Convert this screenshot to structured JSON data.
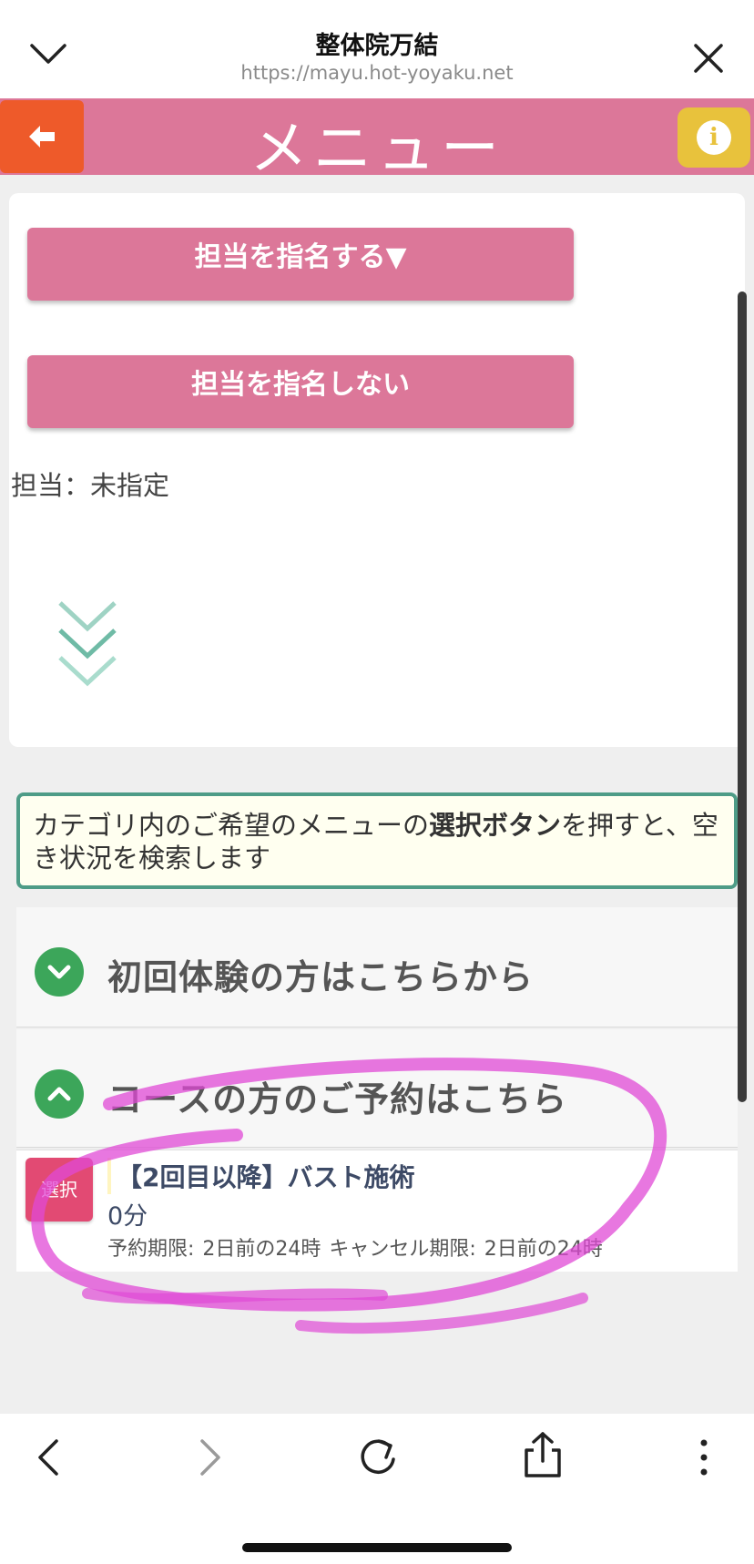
{
  "browser": {
    "site_title": "整体院万結",
    "url": "https://mayu.hot-yoyaku.net"
  },
  "header": {
    "title": "メニュー",
    "info_glyph": "i"
  },
  "staff": {
    "nominate_button": "担当を指名する▼",
    "no_nominate_button": "担当を指名しない",
    "status": "担当：未指定"
  },
  "notice": {
    "text_before": "カテゴリ内のご希望のメニューの",
    "text_bold": "選択ボタン",
    "text_after": "を押すと、空き状況を検索します"
  },
  "categories": [
    {
      "label": "初回体験の方はこちらから",
      "expanded": false
    },
    {
      "label": "コースの方のご予約はこちら",
      "expanded": true
    }
  ],
  "menu_item": {
    "select_label": "選択",
    "title": "【2回目以降】バスト施術",
    "duration": "0分",
    "limits": "予約期限: 2日前の24時  キャンセル期限: 2日前の24時"
  },
  "colors": {
    "header_pink": "#dc7799",
    "back_orange": "#ee5a2a",
    "info_yellow": "#e8c23c",
    "accent_green": "#3ca65a",
    "notice_border": "#4e9c87",
    "select_pink": "#e24a73",
    "scribble_magenta": "#e04ad6"
  },
  "icons": {
    "top_left": "chevron-down-icon",
    "top_right": "close-icon",
    "back": "arrow-left-icon",
    "info": "info-icon",
    "scroll_hint": "triple-chevron-down-icon",
    "nav": [
      "back-icon",
      "forward-icon",
      "reload-icon",
      "share-icon",
      "more-icon"
    ]
  }
}
